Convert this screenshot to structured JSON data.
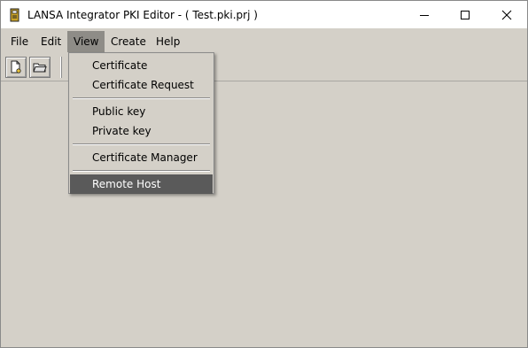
{
  "window": {
    "title": "LANSA Integrator PKI Editor - ( Test.pki.prj )"
  },
  "menubar": {
    "items": [
      {
        "label": "File"
      },
      {
        "label": "Edit"
      },
      {
        "label": "View"
      },
      {
        "label": "Create"
      },
      {
        "label": "Help"
      }
    ],
    "active": "View"
  },
  "toolbar": {
    "buttons": [
      {
        "icon": "new-document-icon"
      },
      {
        "icon": "open-folder-icon"
      }
    ]
  },
  "view_menu": {
    "items": [
      {
        "label": "Certificate"
      },
      {
        "label": "Certificate Request"
      },
      {
        "label": "Public key"
      },
      {
        "label": "Private key"
      },
      {
        "label": "Certificate Manager"
      },
      {
        "label": "Remote Host"
      }
    ],
    "highlighted": "Remote Host"
  },
  "colors": {
    "background": "#d4d0c8",
    "menu_active": "#8e8c87",
    "highlight": "#5a5a5a"
  }
}
